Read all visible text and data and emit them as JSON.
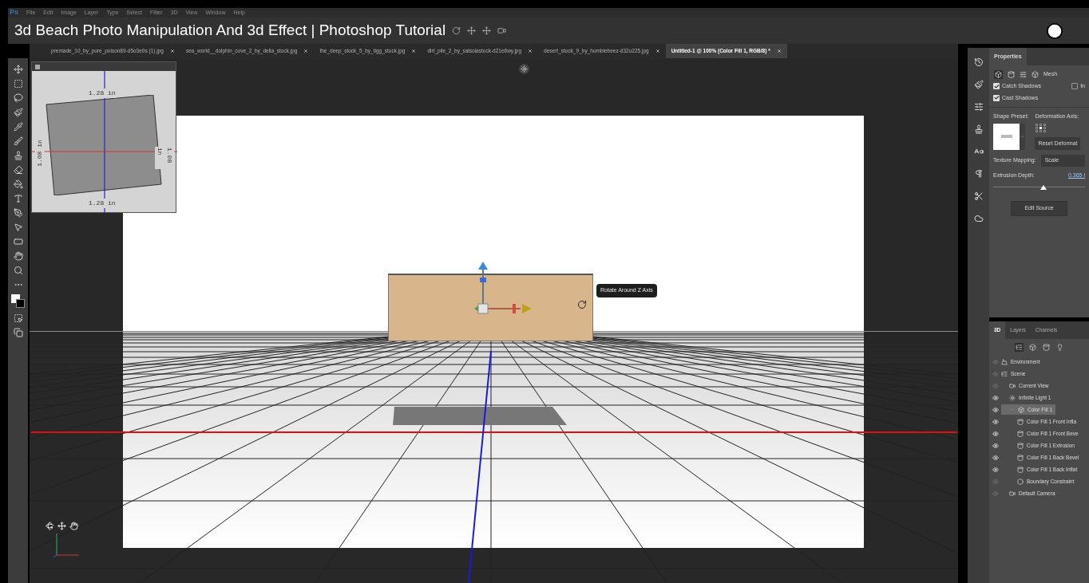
{
  "menu": {
    "logo": "Ps",
    "items": [
      "File",
      "Edit",
      "Image",
      "Layer",
      "Type",
      "Select",
      "Filter",
      "3D",
      "View",
      "Window",
      "Help"
    ]
  },
  "title_overlay": "3d Beach Photo Manipulation And 3d Effect | Photoshop Tutorial",
  "tabs": [
    {
      "label": "premade_10_by_pure_poison89-d5o3e0s (1).jpg",
      "selected": false
    },
    {
      "label": "sea_world__dolphin_cove_2_by_della_stock.jpg",
      "selected": false
    },
    {
      "label": "the_deep_stock_5_by_tigg_stock.jpg",
      "selected": false
    },
    {
      "label": "dirt_pile_2_by_salsolastock-d21e6wy.jpg",
      "selected": false
    },
    {
      "label": "desert_stock_9_by_humblebeez-d32u225.jpg",
      "selected": false
    },
    {
      "label": "Untitled-1 @ 100% (Color Fill 1, RGB/8) *",
      "selected": true
    }
  ],
  "navigator": {
    "top": "1.28 in",
    "bottom": "1.28 in",
    "left": "1.08 in",
    "right": "1.08 in"
  },
  "tooltip": "Rotate Around Z Axis",
  "properties": {
    "tab": "Properties",
    "mode_label": "Mesh",
    "checkboxes": [
      {
        "label": "Catch Shadows",
        "checked": true
      },
      {
        "label": "In",
        "checked": false
      },
      {
        "label": "Cast Shadows",
        "checked": true
      }
    ],
    "shape_preset_label": "Shape Preset:",
    "deformation_axis_label": "Deformation Axis:",
    "reset_button": "Reset Deformat",
    "texture_mapping_label": "Texture Mapping:",
    "texture_mapping_value": "Scale",
    "extrusion_label": "Extrusion Depth:",
    "extrusion_value": "0.365 i",
    "extrusion_slider": {
      "level": 0.55
    },
    "edit_source_button": "Edit Source"
  },
  "scene_panel": {
    "tabs": [
      {
        "label": "3D",
        "selected": true
      },
      {
        "label": "Layers",
        "selected": false
      },
      {
        "label": "Channels",
        "selected": false
      }
    ],
    "filters": [
      {
        "kind": "scene",
        "selected": true
      },
      {
        "kind": "mesh",
        "selected": false
      },
      {
        "kind": "material",
        "selected": false
      },
      {
        "kind": "light",
        "selected": false
      }
    ],
    "tree": [
      {
        "label": "Environment",
        "kind": "environment",
        "visible": false,
        "selected": false
      },
      {
        "label": "Scene",
        "kind": "scene",
        "visible": false,
        "selected": false,
        "children": [
          {
            "label": "Current View",
            "kind": "camera",
            "visible": false,
            "selected": false
          },
          {
            "label": "Infinite Light 1",
            "kind": "light",
            "visible": true,
            "selected": false
          },
          {
            "label": "Color Fill 1",
            "kind": "mesh",
            "visible": true,
            "selected": true,
            "expanded": true,
            "children": [
              {
                "label": "Color Fill 1 Front Infla",
                "kind": "material",
                "visible": true,
                "selected": false
              },
              {
                "label": "Color Fill 1 Front Beve",
                "kind": "material",
                "visible": true,
                "selected": false
              },
              {
                "label": "Color Fill 1 Extrusion",
                "kind": "material",
                "visible": true,
                "selected": false
              },
              {
                "label": "Color Fill 1 Back Bevel",
                "kind": "material",
                "visible": true,
                "selected": false
              },
              {
                "label": "Color Fill 1 Back Inflat",
                "kind": "material",
                "visible": true,
                "selected": false
              },
              {
                "label": "Boundary Constraint",
                "kind": "constraint",
                "visible": false,
                "selected": false
              }
            ]
          },
          {
            "label": "Default Camera",
            "kind": "camera",
            "visible": false,
            "selected": false
          }
        ]
      }
    ]
  }
}
